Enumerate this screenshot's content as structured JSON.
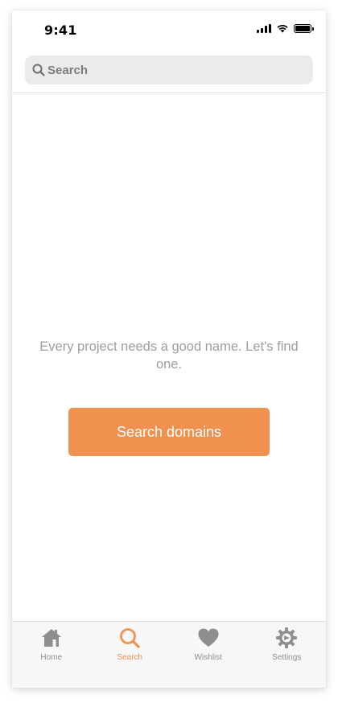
{
  "status_bar": {
    "time": "9:41"
  },
  "search": {
    "placeholder": "Search"
  },
  "main": {
    "message": "Every project needs a good name. Let's find one.",
    "button_label": "Search domains"
  },
  "tab_bar": {
    "tabs": [
      {
        "label": "Home",
        "icon": "home-icon",
        "active": false
      },
      {
        "label": "Search",
        "icon": "search-icon",
        "active": true
      },
      {
        "label": "Wishlist",
        "icon": "heart-icon",
        "active": false
      },
      {
        "label": "Settings",
        "icon": "gear-icon",
        "active": false
      }
    ]
  },
  "colors": {
    "accent": "#f0914f",
    "inactive": "#8e8e8e",
    "text_muted": "#9e9e9e",
    "search_bg": "#ebebeb"
  }
}
